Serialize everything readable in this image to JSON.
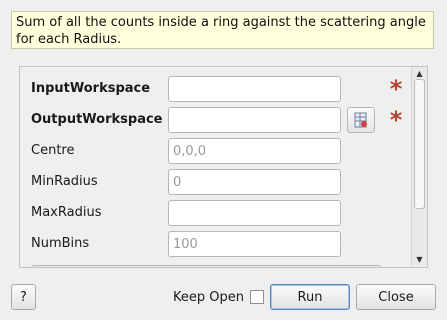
{
  "description": "Sum of all the counts inside a ring against the scattering angle for each Radius.",
  "properties": [
    {
      "label": "InputWorkspace",
      "bold": true,
      "value": "",
      "placeholder": "",
      "required": true,
      "browse": false
    },
    {
      "label": "OutputWorkspace",
      "bold": true,
      "value": "",
      "placeholder": "",
      "required": true,
      "browse": true
    },
    {
      "label": "Centre",
      "bold": false,
      "value": "",
      "placeholder": "0,0,0",
      "required": false,
      "browse": false
    },
    {
      "label": "MinRadius",
      "bold": false,
      "value": "",
      "placeholder": "0",
      "required": false,
      "browse": false
    },
    {
      "label": "MaxRadius",
      "bold": false,
      "value": "",
      "placeholder": "",
      "required": false,
      "browse": false
    },
    {
      "label": "NumBins",
      "bold": false,
      "value": "",
      "placeholder": "100",
      "required": false,
      "browse": false
    }
  ],
  "required_marker": "*",
  "buttons": {
    "help": "?",
    "keep_open": "Keep Open",
    "keep_open_checked": false,
    "run": "Run",
    "close": "Close"
  },
  "colors": {
    "required_star": "#b2432f",
    "description_bg": "#ffffdc",
    "default_button_border": "#5a87c2"
  }
}
